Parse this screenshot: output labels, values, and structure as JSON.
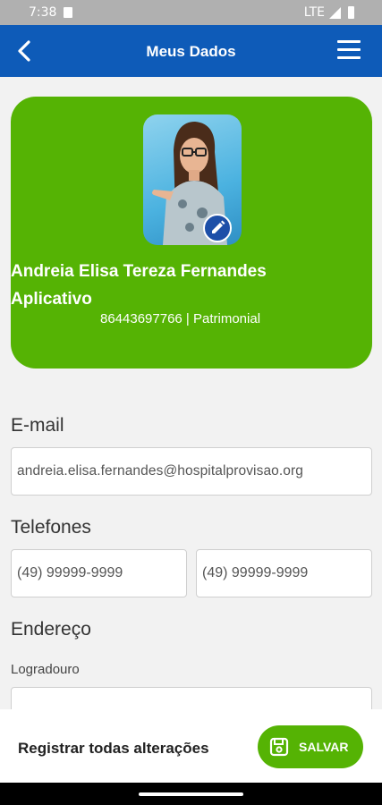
{
  "status_bar": {
    "time": "7:38",
    "network": "LTE"
  },
  "app_bar": {
    "title": "Meus Dados"
  },
  "profile": {
    "name": "Andreia Elisa Tereza Fernandes Aplicativo",
    "subtitle": "86443697766 | Patrimonial"
  },
  "email": {
    "label": "E-mail",
    "value": "andreia.elisa.fernandes@hospitalprovisao.org"
  },
  "phones": {
    "label": "Telefones",
    "phone1": "(49) 99999-9999",
    "phone2": "(49) 99999-9999"
  },
  "address": {
    "label": "Endereço",
    "street_label": "Logradouro",
    "street_value": ""
  },
  "bottom": {
    "label": "Registrar todas alterações",
    "save_label": "SALVAR"
  },
  "colors": {
    "primary_blue": "#0e5bb8",
    "accent_green": "#55b304",
    "background": "#f2f2f2"
  },
  "icons": [
    "back-arrow-icon",
    "menu-icon",
    "pencil-icon",
    "save-icon"
  ]
}
